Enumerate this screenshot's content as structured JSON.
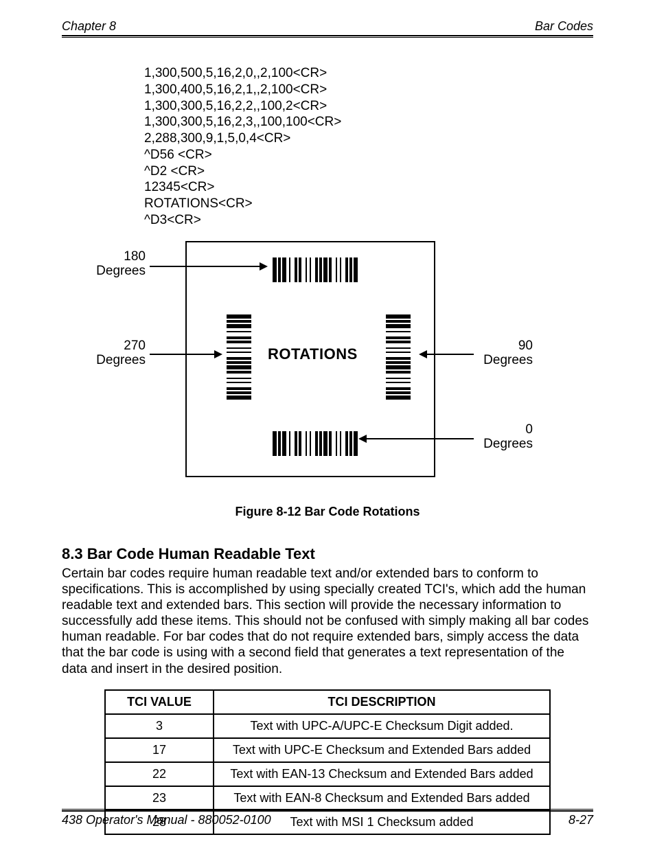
{
  "header": {
    "left": "Chapter 8",
    "right": "Bar Codes"
  },
  "code_lines": [
    "1,300,500,5,16,2,0,,2,100<CR>",
    "1,300,400,5,16,2,1,,2,100<CR>",
    "1,300,300,5,16,2,2,,100,2<CR>",
    "1,300,300,5,16,2,3,,100,100<CR>",
    "2,288,300,9,1,5,0,4<CR>",
    "^D56 <CR>",
    "^D2 <CR>",
    "12345<CR>",
    "ROTATIONS<CR>",
    "^D3<CR>"
  ],
  "figure": {
    "labels": {
      "d180": "180 Degrees",
      "d270": "270 Degrees",
      "d90": "90 Degrees",
      "d0": "0 Degrees"
    },
    "center_text": "ROTATIONS",
    "caption": "Figure 8-12  Bar Code Rotations"
  },
  "section": {
    "heading": "8.3  Bar Code Human Readable Text",
    "body": "Certain bar codes require human readable text and/or extended bars to conform to specifications.  This is accomplished by using specially created TCI's, which add the human readable text and extended bars.  This section will provide the necessary information to successfully add these items.  This should not be confused with simply making all bar codes human readable.  For bar codes that do not require extended bars, simply access the data that the bar code is using with a second field that generates a text representation of the data and insert in the desired position."
  },
  "table": {
    "headers": [
      "TCI VALUE",
      "TCI DESCRIPTION"
    ],
    "rows": [
      [
        "3",
        "Text with UPC-A/UPC-E Checksum Digit added."
      ],
      [
        "17",
        "Text with UPC-E Checksum and Extended Bars added"
      ],
      [
        "22",
        "Text with EAN-13 Checksum and Extended Bars added"
      ],
      [
        "23",
        "Text with EAN-8 Checksum and Extended Bars added"
      ],
      [
        "28",
        "Text with MSI 1 Checksum added"
      ]
    ]
  },
  "footer": {
    "left": "438 Operator's Manual - 880052-0100",
    "right": "8-27"
  }
}
